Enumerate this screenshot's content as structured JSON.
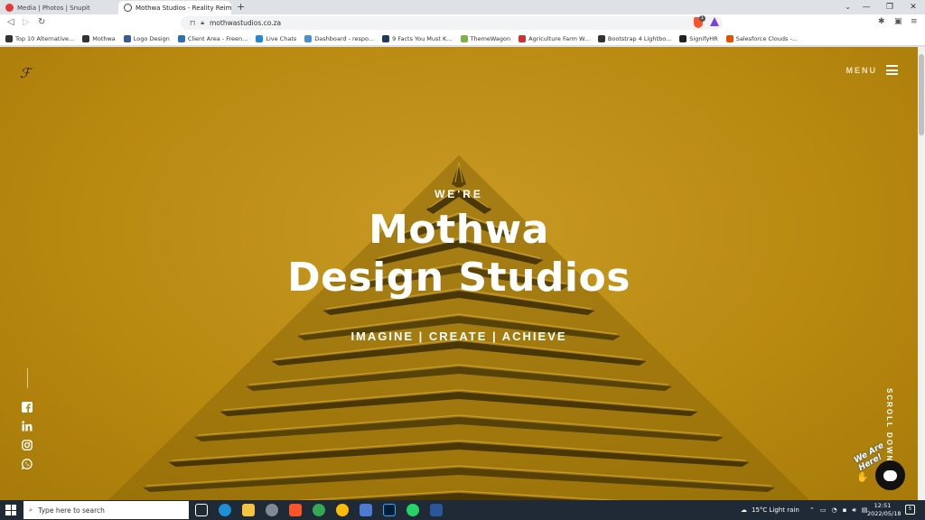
{
  "browser": {
    "tabs": [
      {
        "title": "Media | Photos | Snupit",
        "icon": "snupit-favicon",
        "color": "#e53935"
      },
      {
        "title": "Mothwa Studios - Reality Reimagi",
        "icon": "mothwa-favicon",
        "color": "#444444"
      }
    ],
    "new_tab": "+",
    "url": "mothwastudios.co.za",
    "shield_count": "1",
    "bookmarks": [
      {
        "label": "Top 10 Alternative...",
        "color": "#333333"
      },
      {
        "label": "Mothwa",
        "color": "#333333"
      },
      {
        "label": "Logo Design",
        "color": "#3a5aa0"
      },
      {
        "label": "Client Area - Freen...",
        "color": "#2f6fb5"
      },
      {
        "label": "Live Chats",
        "color": "#1e88e5"
      },
      {
        "label": "Dashboard - respo...",
        "color": "#4a90d9"
      },
      {
        "label": "9 Facts You Must K...",
        "color": "#1e3a5f"
      },
      {
        "label": "ThemeWagon",
        "color": "#7cb342"
      },
      {
        "label": "Agriculture Farm W...",
        "color": "#d32f2f"
      },
      {
        "label": "Bootstrap 4 Lightbo...",
        "color": "#333333"
      },
      {
        "label": "SignifyHR",
        "color": "#222222"
      },
      {
        "label": "Salesforce Clouds -...",
        "color": "#e65100"
      }
    ]
  },
  "site": {
    "menu_label": "MENU",
    "pre_title": "WE'RE",
    "title_line1": "Mothwa",
    "title_line2": "Design Studios",
    "tagline": "IMAGINE | CREATE | ACHIEVE",
    "scroll_label": "SCROLL DOWN",
    "chat_badge": "We Are Here!",
    "social": [
      "facebook-icon",
      "linkedin-icon",
      "instagram-icon",
      "whatsapp-icon"
    ],
    "accent": "#b8890f"
  },
  "taskbar": {
    "search_placeholder": "Type here to search",
    "weather": "15°C  Light rain",
    "time": "12:51",
    "date": "2022/05/18",
    "notifications": "5"
  }
}
